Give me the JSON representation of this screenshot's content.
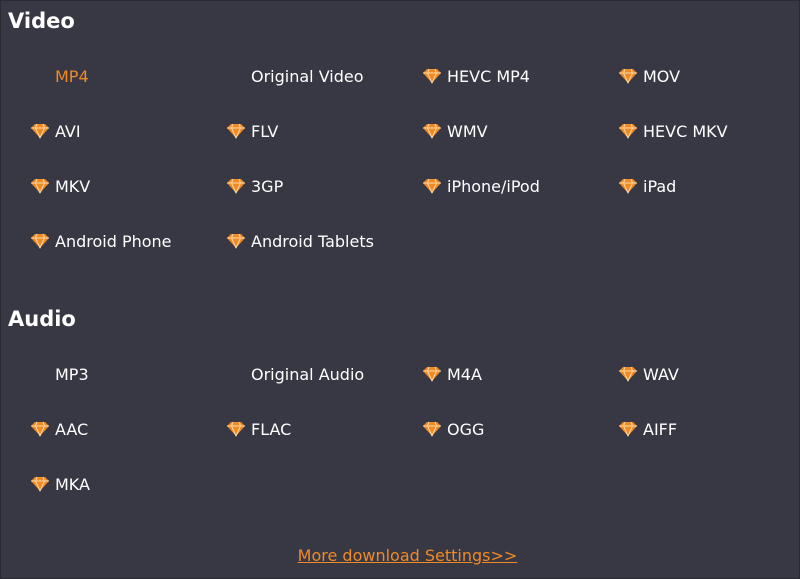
{
  "accent_color": "#f08a24",
  "premium_icon": "diamond-icon",
  "video": {
    "title": "Video",
    "options": [
      {
        "label": "MP4",
        "premium": false,
        "selected": true
      },
      {
        "label": "Original Video",
        "premium": false,
        "selected": false
      },
      {
        "label": "HEVC MP4",
        "premium": true,
        "selected": false
      },
      {
        "label": "MOV",
        "premium": true,
        "selected": false
      },
      {
        "label": "AVI",
        "premium": true,
        "selected": false
      },
      {
        "label": "FLV",
        "premium": true,
        "selected": false
      },
      {
        "label": "WMV",
        "premium": true,
        "selected": false
      },
      {
        "label": "HEVC MKV",
        "premium": true,
        "selected": false
      },
      {
        "label": "MKV",
        "premium": true,
        "selected": false
      },
      {
        "label": "3GP",
        "premium": true,
        "selected": false
      },
      {
        "label": "iPhone/iPod",
        "premium": true,
        "selected": false
      },
      {
        "label": "iPad",
        "premium": true,
        "selected": false
      },
      {
        "label": "Android Phone",
        "premium": true,
        "selected": false
      },
      {
        "label": "Android Tablets",
        "premium": true,
        "selected": false
      }
    ]
  },
  "audio": {
    "title": "Audio",
    "options": [
      {
        "label": "MP3",
        "premium": false,
        "selected": false
      },
      {
        "label": "Original Audio",
        "premium": false,
        "selected": false
      },
      {
        "label": "M4A",
        "premium": true,
        "selected": false
      },
      {
        "label": "WAV",
        "premium": true,
        "selected": false
      },
      {
        "label": "AAC",
        "premium": true,
        "selected": false
      },
      {
        "label": "FLAC",
        "premium": true,
        "selected": false
      },
      {
        "label": "OGG",
        "premium": true,
        "selected": false
      },
      {
        "label": "AIFF",
        "premium": true,
        "selected": false
      },
      {
        "label": "MKA",
        "premium": true,
        "selected": false
      }
    ]
  },
  "more_link": "More download Settings>>"
}
